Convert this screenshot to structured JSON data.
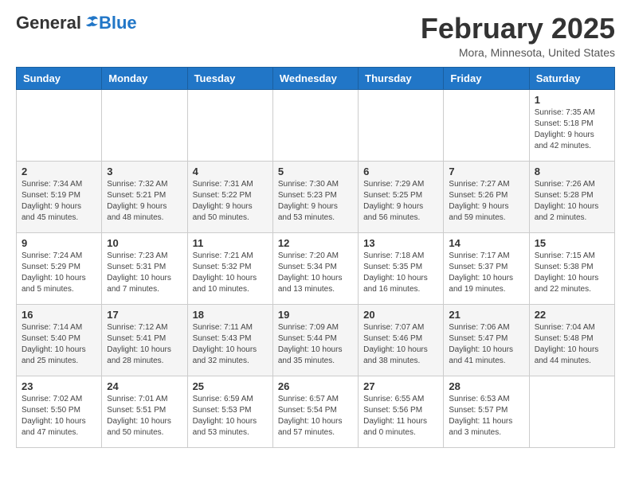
{
  "header": {
    "logo_general": "General",
    "logo_blue": "Blue",
    "month_year": "February 2025",
    "location": "Mora, Minnesota, United States"
  },
  "days_of_week": [
    "Sunday",
    "Monday",
    "Tuesday",
    "Wednesday",
    "Thursday",
    "Friday",
    "Saturday"
  ],
  "weeks": [
    [
      {
        "day": "",
        "info": ""
      },
      {
        "day": "",
        "info": ""
      },
      {
        "day": "",
        "info": ""
      },
      {
        "day": "",
        "info": ""
      },
      {
        "day": "",
        "info": ""
      },
      {
        "day": "",
        "info": ""
      },
      {
        "day": "1",
        "info": "Sunrise: 7:35 AM\nSunset: 5:18 PM\nDaylight: 9 hours and 42 minutes."
      }
    ],
    [
      {
        "day": "2",
        "info": "Sunrise: 7:34 AM\nSunset: 5:19 PM\nDaylight: 9 hours and 45 minutes."
      },
      {
        "day": "3",
        "info": "Sunrise: 7:32 AM\nSunset: 5:21 PM\nDaylight: 9 hours and 48 minutes."
      },
      {
        "day": "4",
        "info": "Sunrise: 7:31 AM\nSunset: 5:22 PM\nDaylight: 9 hours and 50 minutes."
      },
      {
        "day": "5",
        "info": "Sunrise: 7:30 AM\nSunset: 5:23 PM\nDaylight: 9 hours and 53 minutes."
      },
      {
        "day": "6",
        "info": "Sunrise: 7:29 AM\nSunset: 5:25 PM\nDaylight: 9 hours and 56 minutes."
      },
      {
        "day": "7",
        "info": "Sunrise: 7:27 AM\nSunset: 5:26 PM\nDaylight: 9 hours and 59 minutes."
      },
      {
        "day": "8",
        "info": "Sunrise: 7:26 AM\nSunset: 5:28 PM\nDaylight: 10 hours and 2 minutes."
      }
    ],
    [
      {
        "day": "9",
        "info": "Sunrise: 7:24 AM\nSunset: 5:29 PM\nDaylight: 10 hours and 5 minutes."
      },
      {
        "day": "10",
        "info": "Sunrise: 7:23 AM\nSunset: 5:31 PM\nDaylight: 10 hours and 7 minutes."
      },
      {
        "day": "11",
        "info": "Sunrise: 7:21 AM\nSunset: 5:32 PM\nDaylight: 10 hours and 10 minutes."
      },
      {
        "day": "12",
        "info": "Sunrise: 7:20 AM\nSunset: 5:34 PM\nDaylight: 10 hours and 13 minutes."
      },
      {
        "day": "13",
        "info": "Sunrise: 7:18 AM\nSunset: 5:35 PM\nDaylight: 10 hours and 16 minutes."
      },
      {
        "day": "14",
        "info": "Sunrise: 7:17 AM\nSunset: 5:37 PM\nDaylight: 10 hours and 19 minutes."
      },
      {
        "day": "15",
        "info": "Sunrise: 7:15 AM\nSunset: 5:38 PM\nDaylight: 10 hours and 22 minutes."
      }
    ],
    [
      {
        "day": "16",
        "info": "Sunrise: 7:14 AM\nSunset: 5:40 PM\nDaylight: 10 hours and 25 minutes."
      },
      {
        "day": "17",
        "info": "Sunrise: 7:12 AM\nSunset: 5:41 PM\nDaylight: 10 hours and 28 minutes."
      },
      {
        "day": "18",
        "info": "Sunrise: 7:11 AM\nSunset: 5:43 PM\nDaylight: 10 hours and 32 minutes."
      },
      {
        "day": "19",
        "info": "Sunrise: 7:09 AM\nSunset: 5:44 PM\nDaylight: 10 hours and 35 minutes."
      },
      {
        "day": "20",
        "info": "Sunrise: 7:07 AM\nSunset: 5:46 PM\nDaylight: 10 hours and 38 minutes."
      },
      {
        "day": "21",
        "info": "Sunrise: 7:06 AM\nSunset: 5:47 PM\nDaylight: 10 hours and 41 minutes."
      },
      {
        "day": "22",
        "info": "Sunrise: 7:04 AM\nSunset: 5:48 PM\nDaylight: 10 hours and 44 minutes."
      }
    ],
    [
      {
        "day": "23",
        "info": "Sunrise: 7:02 AM\nSunset: 5:50 PM\nDaylight: 10 hours and 47 minutes."
      },
      {
        "day": "24",
        "info": "Sunrise: 7:01 AM\nSunset: 5:51 PM\nDaylight: 10 hours and 50 minutes."
      },
      {
        "day": "25",
        "info": "Sunrise: 6:59 AM\nSunset: 5:53 PM\nDaylight: 10 hours and 53 minutes."
      },
      {
        "day": "26",
        "info": "Sunrise: 6:57 AM\nSunset: 5:54 PM\nDaylight: 10 hours and 57 minutes."
      },
      {
        "day": "27",
        "info": "Sunrise: 6:55 AM\nSunset: 5:56 PM\nDaylight: 11 hours and 0 minutes."
      },
      {
        "day": "28",
        "info": "Sunrise: 6:53 AM\nSunset: 5:57 PM\nDaylight: 11 hours and 3 minutes."
      },
      {
        "day": "",
        "info": ""
      }
    ]
  ]
}
